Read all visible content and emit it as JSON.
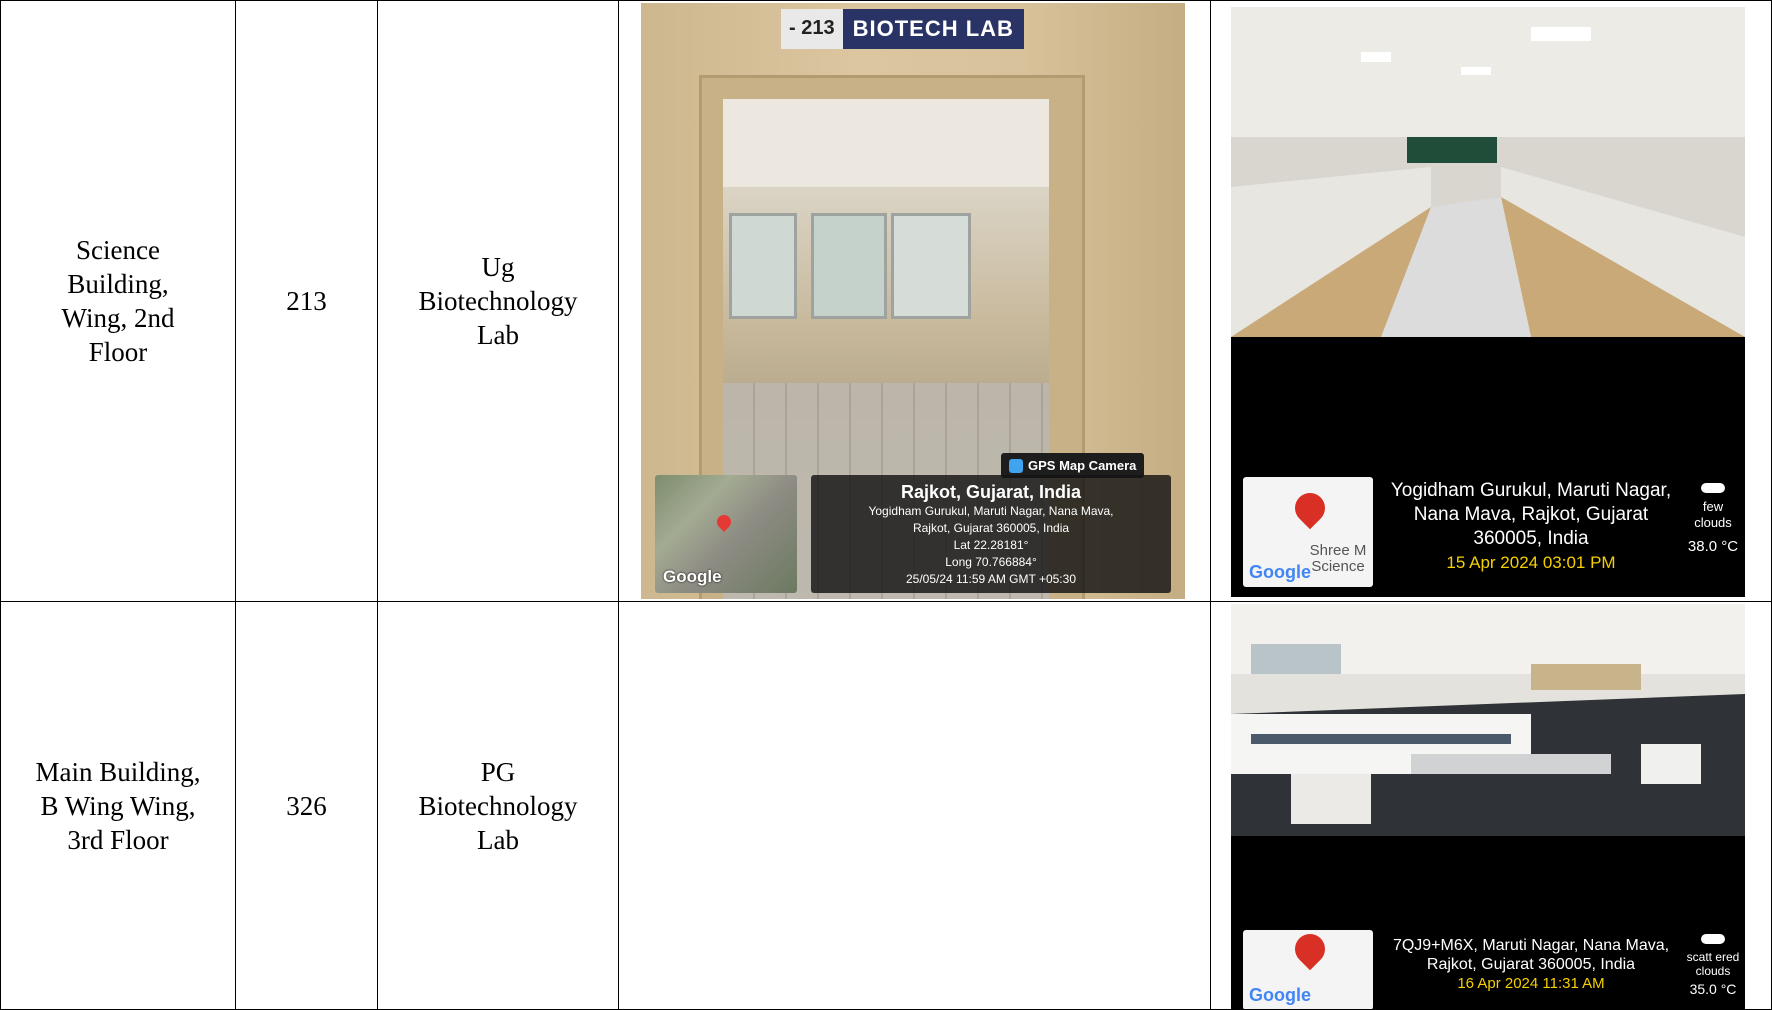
{
  "rows": [
    {
      "location": "Science\nBuilding,\nWing, 2nd\nFloor",
      "room": "213",
      "lab": "Ug\nBiotechnology\nLab",
      "photo1": {
        "sign_number": "- 213",
        "sign_name": "BIOTECH LAB",
        "badge": "GPS Map Camera",
        "map_logo": "Google",
        "title": "Rajkot, Gujarat, India",
        "address": "Yogidham Gurukul, Maruti Nagar, Nana Mava,",
        "address2": "Rajkot, Gujarat 360005, India",
        "lat": "Lat 22.28181°",
        "long": "Long 70.766884°",
        "datetime": "25/05/24 11:59 AM GMT +05:30"
      },
      "photo2": {
        "address": "Yogidham Gurukul, Maruti Nagar, Nana Mava, Rajkot, Gujarat 360005, India",
        "date": "15 Apr 2024 03:01 PM",
        "weather": "few clouds",
        "temperature": "38.0 °C",
        "map_logo": "Google",
        "map_caption": "Shree M Science"
      }
    },
    {
      "location": "Main Building,\nB Wing Wing,\n3rd Floor",
      "room": "326",
      "lab": "PG\nBiotechnology\nLab",
      "photo2": {
        "address": "7QJ9+M6X, Maruti Nagar, Nana Mava, Rajkot, Gujarat 360005, India",
        "date": "16 Apr 2024 11:31 AM",
        "weather": "scatt ered clouds",
        "temperature": "35.0 °C",
        "map_logo": "Google"
      }
    }
  ],
  "colors": {
    "border": "#000000",
    "sign_bg": "#2a3366",
    "date_text": "#f5d000",
    "pin": "#d93025"
  },
  "icons": [
    "map-pin-icon",
    "cloud-icon",
    "gps-camera-icon"
  ]
}
